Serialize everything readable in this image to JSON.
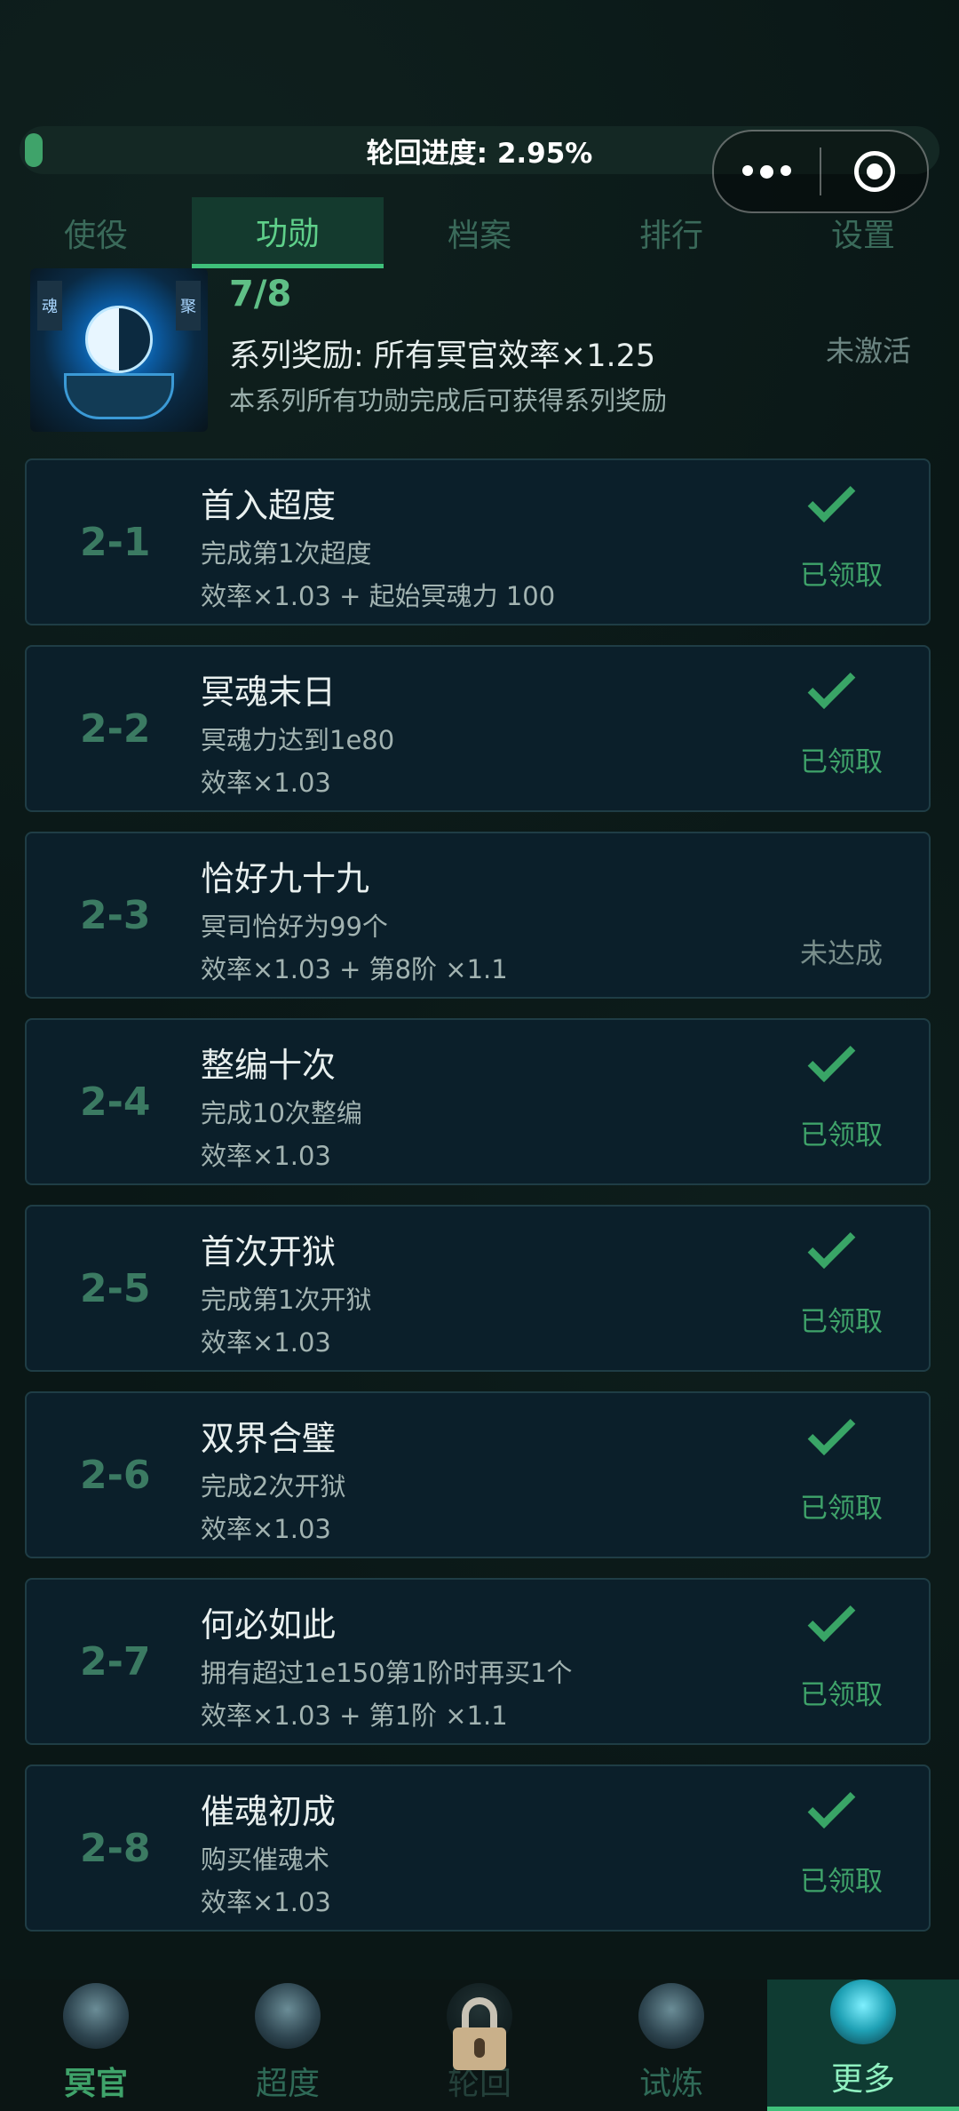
{
  "progress": {
    "label": "轮回进度: 2.95%",
    "value_percent": 2.95
  },
  "capsule": {
    "more_icon": "more-dots-icon",
    "close_icon": "target-icon"
  },
  "tabs": [
    {
      "label": "使役",
      "active": false
    },
    {
      "label": "功勋",
      "active": true
    },
    {
      "label": "档案",
      "active": false
    },
    {
      "label": "排行",
      "active": false
    },
    {
      "label": "设置",
      "active": false
    }
  ],
  "series": {
    "image_tags": [
      "魂",
      "聚"
    ],
    "count": "7/8",
    "reward": "系列奖励: 所有冥官效率×1.25",
    "desc": "本系列所有功勋完成后可获得系列奖励",
    "status": "未激活"
  },
  "achievements": [
    {
      "code": "2-1",
      "name": "首入超度",
      "condition": "完成第1次超度",
      "reward": "效率×1.03 + 起始冥魂力 100",
      "status": "已领取",
      "claimed": true
    },
    {
      "code": "2-2",
      "name": "冥魂末日",
      "condition": "冥魂力达到1e80",
      "reward": "效率×1.03",
      "status": "已领取",
      "claimed": true
    },
    {
      "code": "2-3",
      "name": "恰好九十九",
      "condition": "冥司恰好为99个",
      "reward": "效率×1.03 + 第8阶 ×1.1",
      "status": "未达成",
      "claimed": false
    },
    {
      "code": "2-4",
      "name": "整编十次",
      "condition": "完成10次整编",
      "reward": "效率×1.03",
      "status": "已领取",
      "claimed": true
    },
    {
      "code": "2-5",
      "name": "首次开狱",
      "condition": "完成第1次开狱",
      "reward": "效率×1.03",
      "status": "已领取",
      "claimed": true
    },
    {
      "code": "2-6",
      "name": "双界合璧",
      "condition": "完成2次开狱",
      "reward": "效率×1.03",
      "status": "已领取",
      "claimed": true
    },
    {
      "code": "2-7",
      "name": "何必如此",
      "condition": "拥有超过1e150第1阶时再买1个",
      "reward": "效率×1.03 + 第1阶 ×1.1",
      "status": "已领取",
      "claimed": true
    },
    {
      "code": "2-8",
      "name": "催魂初成",
      "condition": "购买催魂术",
      "reward": "效率×1.03",
      "status": "已领取",
      "claimed": true
    }
  ],
  "bottom_nav": [
    {
      "label": "冥官",
      "icon": "ghost-officer-icon",
      "active": false,
      "locked": false
    },
    {
      "label": "超度",
      "icon": "temple-icon",
      "active": false,
      "locked": false
    },
    {
      "label": "轮回",
      "icon": "lock-icon",
      "active": false,
      "locked": true
    },
    {
      "label": "试炼",
      "icon": "flame-icon",
      "active": false,
      "locked": false
    },
    {
      "label": "更多",
      "icon": "crystal-icon",
      "active": true,
      "locked": false
    }
  ],
  "colors": {
    "accent": "#3fa36a",
    "card_bg": "#0b1f2a",
    "tab_active_bg": "#143a2e"
  }
}
